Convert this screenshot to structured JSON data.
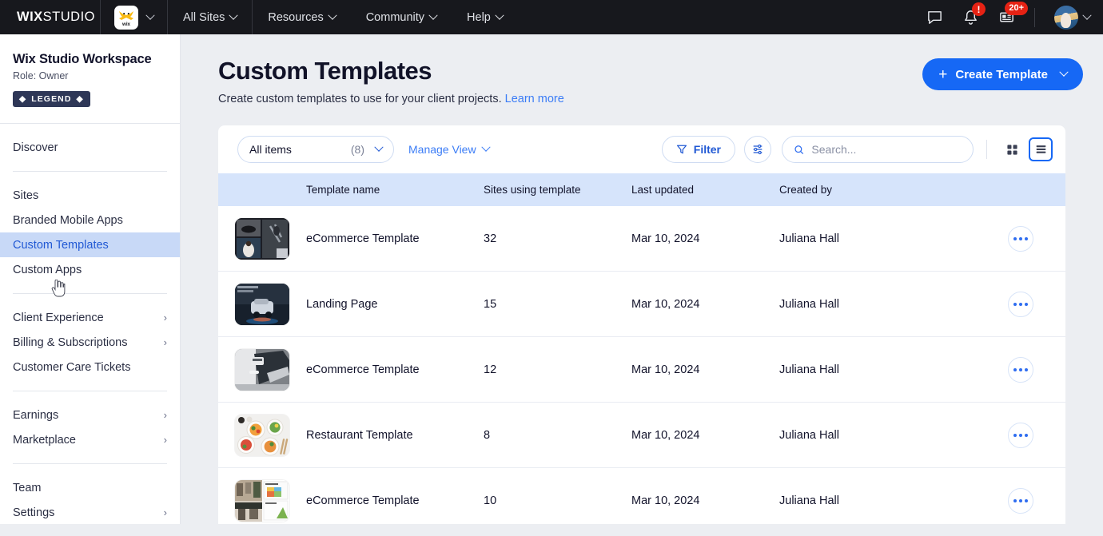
{
  "topbar": {
    "logo_bold": "WIX",
    "logo_light": "STUDIO",
    "wix_mark_label": "wix",
    "menus": [
      {
        "label": "All Sites"
      },
      {
        "label": "Resources"
      },
      {
        "label": "Community"
      },
      {
        "label": "Help"
      }
    ],
    "icons": {
      "chat": "chat-icon",
      "notifications": "bell-icon",
      "notifications_badge": "!",
      "news": "news-card-icon",
      "news_badge": "20+",
      "avatar": "avatar"
    }
  },
  "sidebar": {
    "workspace_title": "Wix Studio Workspace",
    "role": "Role: Owner",
    "badge": "LEGEND",
    "badge_glyph": "◆",
    "groups": [
      {
        "items": [
          {
            "label": "Discover",
            "active": false,
            "arrow": false
          }
        ]
      },
      {
        "items": [
          {
            "label": "Sites",
            "active": false,
            "arrow": false
          },
          {
            "label": "Branded Mobile Apps",
            "active": false,
            "arrow": false
          },
          {
            "label": "Custom Templates",
            "active": true,
            "arrow": false
          },
          {
            "label": "Custom Apps",
            "active": false,
            "arrow": false
          }
        ]
      },
      {
        "items": [
          {
            "label": "Client Experience",
            "active": false,
            "arrow": true
          },
          {
            "label": "Billing & Subscriptions",
            "active": false,
            "arrow": true
          },
          {
            "label": "Customer Care Tickets",
            "active": false,
            "arrow": false
          }
        ]
      },
      {
        "items": [
          {
            "label": "Earnings",
            "active": false,
            "arrow": true
          },
          {
            "label": "Marketplace",
            "active": false,
            "arrow": true
          }
        ]
      },
      {
        "items": [
          {
            "label": "Team",
            "active": false,
            "arrow": false
          },
          {
            "label": "Settings",
            "active": false,
            "arrow": true
          }
        ]
      }
    ]
  },
  "page": {
    "title": "Custom Templates",
    "subtitle": "Create custom templates to use for your client projects.",
    "learn_more": "Learn more",
    "create_button": "Create Template",
    "create_button_plus": "+"
  },
  "toolbar": {
    "filter_select_label": "All items",
    "filter_select_count": "(8)",
    "manage_view": "Manage View",
    "filter_button": "Filter",
    "settings_icon": "sliders-icon",
    "search_placeholder": "Search...",
    "search_value": "",
    "view_grid": "grid-view-icon",
    "view_list": "list-view-icon",
    "active_view": "list"
  },
  "table": {
    "columns": [
      "Template name",
      "Sites using template",
      "Last updated",
      "Created by"
    ],
    "rows": [
      {
        "thumb": "tn1",
        "name": "eCommerce Template",
        "sites": "32",
        "updated": "Mar 10, 2024",
        "creator": "Juliana Hall"
      },
      {
        "thumb": "tn2",
        "name": "Landing Page",
        "sites": "15",
        "updated": "Mar 10, 2024",
        "creator": "Juliana Hall"
      },
      {
        "thumb": "tn3",
        "name": "eCommerce Template",
        "sites": "12",
        "updated": "Mar 10, 2024",
        "creator": "Juliana Hall"
      },
      {
        "thumb": "tn4",
        "name": "Restaurant Template",
        "sites": "8",
        "updated": "Mar 10, 2024",
        "creator": "Juliana Hall"
      },
      {
        "thumb": "tn5",
        "name": "eCommerce Template",
        "sites": "10",
        "updated": "Mar 10, 2024",
        "creator": "Juliana Hall"
      }
    ],
    "row_action": "more-actions"
  },
  "colors": {
    "accent": "#1668f5",
    "link": "#3c7df6",
    "topbar_bg": "#17181d",
    "page_bg": "#eceef2",
    "table_header_bg": "#d6e4fb",
    "active_nav_bg": "#c8d9f7",
    "badge_red": "#e62214",
    "legend_badge_bg": "#2e3757"
  }
}
